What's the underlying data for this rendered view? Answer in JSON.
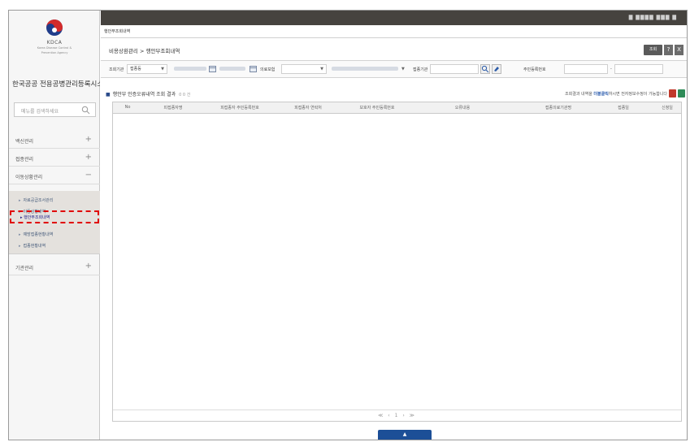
{
  "brand": {
    "logo_text": "KDCA",
    "logo_sub1": "Korea Disease Control &",
    "logo_sub2": "Prevention Agency",
    "system_title": "한국공공 전용공병관리등록시스템"
  },
  "sidebar": {
    "search_placeholder": "메뉴를 검색하세요",
    "groups": [
      {
        "label": "백신관리",
        "toggle": "+"
      },
      {
        "label": "접종관리",
        "toggle": "+"
      },
      {
        "label": "이동상황관리",
        "toggle": "−"
      },
      {
        "label": "기관관리",
        "toggle": "+"
      }
    ],
    "submenu": [
      "자료공급조서관리",
      "이동상황내역",
      "행안부조회내역",
      "예방접종현황내역",
      "접종현황내역"
    ],
    "selected_index": 2
  },
  "topbar": {
    "user": "▇ ▇▇▇▇  ▇▇▇ ▇"
  },
  "tabs": [
    {
      "label": "행안부조회내역"
    }
  ],
  "breadcrumb": "비용상환관리 > 행안부조회내역",
  "buttons": {
    "query": "조회",
    "help": "?",
    "close": "X"
  },
  "filters": {
    "org_label": "조회기관",
    "org_value": "접종등",
    "date_label": "의료보험",
    "region_label": "접종기관",
    "cert_label": "주민등록번호"
  },
  "result": {
    "title": "행안부 인증오류내역 조회 결과",
    "count": "0 0 건",
    "note_prefix": "조회결과 내역을 ",
    "note_bold": "더블클릭",
    "note_suffix": "하시면 전자정보수정이 가능합니다"
  },
  "table": {
    "columns": [
      "No",
      "피접종자명",
      "피접종자 주민등록번호",
      "피접종자 연락처",
      "보호자 주민등록번호",
      "오류내용",
      "접종의료기관명",
      "접종일",
      "신청일"
    ]
  },
  "pager": {
    "text": "≪ ‹ 1 › ≫"
  },
  "scroll_button": "▲"
}
